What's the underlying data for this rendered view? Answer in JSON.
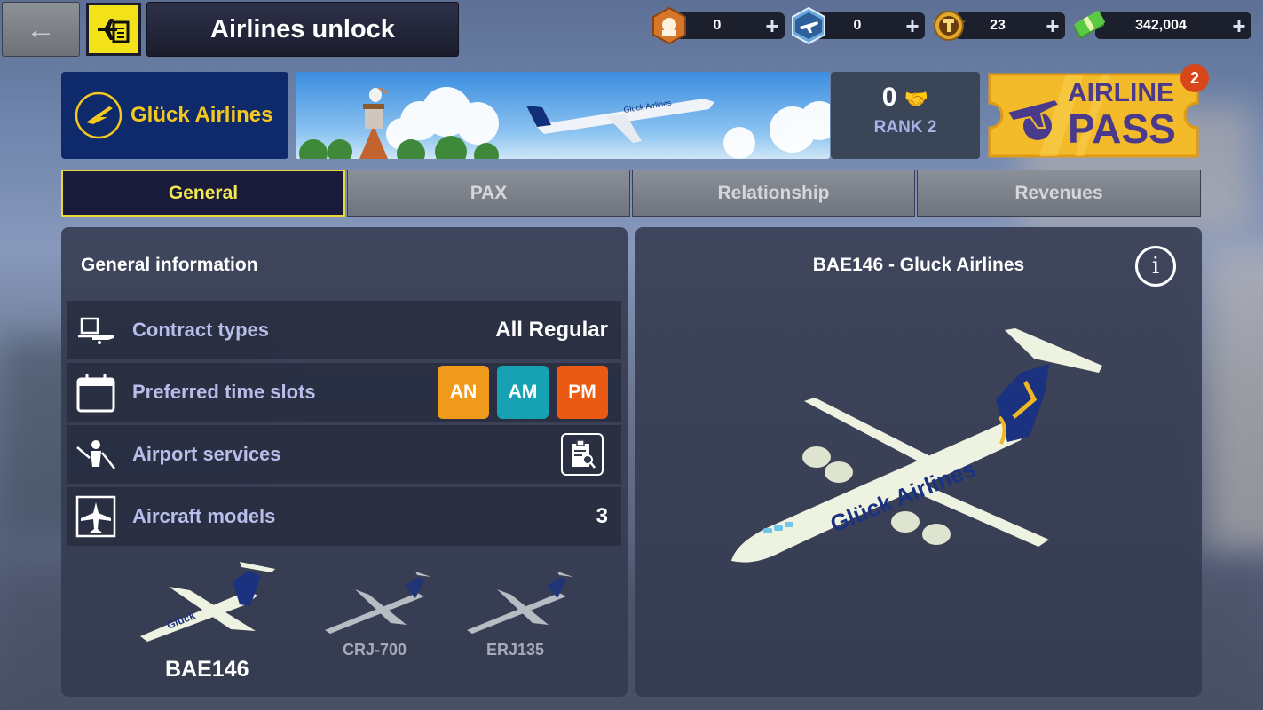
{
  "header": {
    "back_icon": "arrow-left-icon",
    "section_icon": "airline-contract-icon",
    "title": "Airlines unlock"
  },
  "currencies": [
    {
      "name": "engineers",
      "icon": "engineer-badge-icon",
      "value": "0",
      "color": "#d7772a"
    },
    {
      "name": "pilots",
      "icon": "plane-badge-icon",
      "value": "0",
      "color": "#6aa8dc"
    },
    {
      "name": "tower",
      "icon": "control-tower-medal-icon",
      "value": "23",
      "color": "#e2a92a"
    },
    {
      "name": "cash",
      "icon": "cash-stack-icon",
      "value": "342,004",
      "color": "#4fb83a"
    }
  ],
  "airline": {
    "name": "Glück Airlines",
    "relationship_value": "0",
    "rank_label": "RANK 2",
    "brand_color": "#0f2a6b",
    "accent_color": "#f5c81e"
  },
  "airline_pass": {
    "line1": "AIRLINE",
    "line2": "PASS",
    "badge_count": "2"
  },
  "tabs": [
    {
      "label": "General",
      "active": true
    },
    {
      "label": "PAX",
      "active": false
    },
    {
      "label": "Relationship",
      "active": false
    },
    {
      "label": "Revenues",
      "active": false
    }
  ],
  "general_info": {
    "title": "General information",
    "rows": [
      {
        "label": "Contract types",
        "icon": "contract-plane-icon",
        "value": "All Regular"
      },
      {
        "label": "Preferred time slots",
        "icon": "calendar-icon",
        "slots": [
          {
            "label": "AN",
            "color": "#f09a1c"
          },
          {
            "label": "AM",
            "color": "#17a2b4"
          },
          {
            "label": "PM",
            "color": "#ea5a12"
          }
        ]
      },
      {
        "label": "Airport services",
        "icon": "ground-crew-icon",
        "action_icon": "clipboard-search-icon"
      },
      {
        "label": "Aircraft models",
        "icon": "aircraft-hangar-icon",
        "value": "3"
      }
    ],
    "models": [
      {
        "name": "BAE146",
        "selected": true
      },
      {
        "name": "CRJ-700",
        "selected": false
      },
      {
        "name": "ERJ135",
        "selected": false
      }
    ]
  },
  "preview": {
    "title": "BAE146 - Gluck Airlines",
    "info_icon": "info-icon",
    "livery_text": "Glück Airlines"
  }
}
